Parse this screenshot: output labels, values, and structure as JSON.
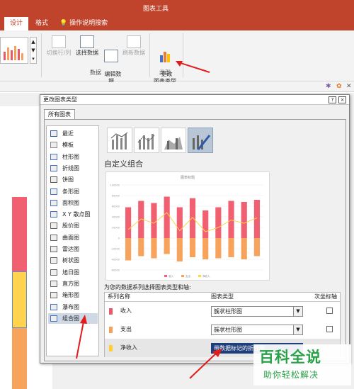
{
  "ribbon": {
    "tool_title": "图表工具",
    "tabs": [
      "设计",
      "格式"
    ],
    "tell_me": "操作说明搜索",
    "buttons": {
      "switch_row_col": "切换行/列",
      "select_data": "选择数据",
      "edit_data": "编辑数\n据",
      "refresh_data": "刷新数据",
      "change_type": "更改\n图表类型"
    },
    "group_labels": {
      "data": "数据",
      "type": "类型"
    }
  },
  "dialog": {
    "title": "更改图表类型",
    "help_btn": "?",
    "close_btn": "×",
    "tab": "所有图表",
    "types": [
      "最近",
      "模板",
      "柱形图",
      "折线图",
      "饼图",
      "条形图",
      "面积图",
      "X Y 散点图",
      "股价图",
      "曲面图",
      "雷达图",
      "树状图",
      "旭日图",
      "直方图",
      "箱形图",
      "瀑布图",
      "组合图"
    ],
    "selected_type": "组合图",
    "section_title": "自定义组合",
    "preview": {
      "chart_title": "图表标题"
    },
    "series_note": "为您的数据系列选择图表类型和轴:",
    "columns": {
      "name": "系列名称",
      "type": "图表类型",
      "secondary": "次坐标轴"
    },
    "series": [
      {
        "name": "收入",
        "chart_type": "簇状柱形图",
        "color": "#e9576a",
        "secondary": false
      },
      {
        "name": "支出",
        "chart_type": "簇状柱形图",
        "color": "#f6a05a",
        "secondary": false
      },
      {
        "name": "净收入",
        "chart_type": "带数据标记的折线图",
        "color": "#ffcc33",
        "secondary": false
      }
    ]
  },
  "chart_data": {
    "type": "bar",
    "title": "图表标题",
    "ylim": [
      -60000,
      100000
    ],
    "yticks": [
      100000,
      80000,
      60000,
      40000,
      20000,
      0,
      -20000,
      -40000,
      -60000
    ],
    "series": [
      {
        "name": "收入",
        "kind": "bar",
        "color": "#f06070",
        "values": [
          58000,
          70000,
          66000,
          78000,
          58000,
          75000,
          52000,
          58000,
          70000,
          68000,
          72000
        ]
      },
      {
        "name": "支出",
        "kind": "bar",
        "color": "#f7a35c",
        "values": [
          -42000,
          -34000,
          -38000,
          -30000,
          -44000,
          -36000,
          -40000,
          -38000,
          -36000,
          -40000,
          -34000
        ]
      },
      {
        "name": "净收入",
        "kind": "line",
        "color": "#ffd34d",
        "values": [
          16000,
          36000,
          28000,
          48000,
          14000,
          39000,
          12000,
          20000,
          34000,
          28000,
          38000
        ]
      }
    ]
  },
  "watermark": {
    "main": "百科全说",
    "sub": "助你轻松解决"
  }
}
